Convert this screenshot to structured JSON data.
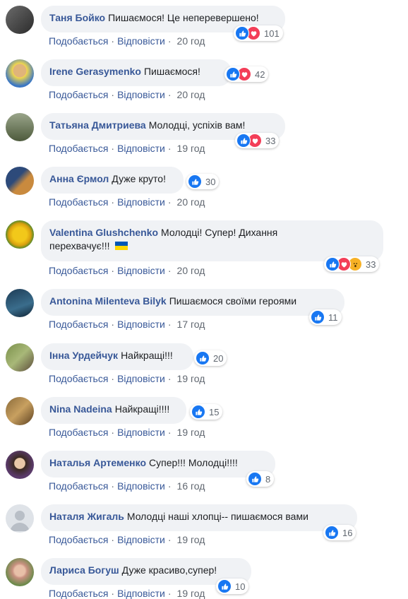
{
  "comments": [
    {
      "author": "Таня Бойко",
      "text": "Пишаємося! Це неперевершено!",
      "like": "Подобається",
      "reply": "Відповісти",
      "time": "20 год",
      "reactions": [
        "like",
        "love"
      ],
      "count": "101"
    },
    {
      "author": "Irene Gerasymenko",
      "text": "Пишаємося!",
      "like": "Подобається",
      "reply": "Відповісти",
      "time": "20 год",
      "reactions": [
        "like",
        "love"
      ],
      "count": "42"
    },
    {
      "author": "Татьяна Дмитриева",
      "text": "Молодці, успіхів вам!",
      "like": "Подобається",
      "reply": "Відповісти",
      "time": "19 год",
      "reactions": [
        "like",
        "love"
      ],
      "count": "33"
    },
    {
      "author": "Анна Єрмол",
      "text": "Дуже круто!",
      "like": "Подобається",
      "reply": "Відповісти",
      "time": "20 год",
      "reactions": [
        "like"
      ],
      "count": "30"
    },
    {
      "author": "Valentina Glushchenko",
      "text": "Молодці! Супер! Дихання",
      "text2": "перехвачує!!!",
      "like": "Подобається",
      "reply": "Відповісти",
      "time": "20 год",
      "reactions": [
        "like",
        "love",
        "wow"
      ],
      "count": "33"
    },
    {
      "author": "Antonina Milenteva Bilyk",
      "text": "Пишаємося своїми героями",
      "like": "Подобається",
      "reply": "Відповісти",
      "time": "17 год",
      "reactions": [
        "like"
      ],
      "count": "11"
    },
    {
      "author": "Інна Урдейчук",
      "text": "Найкращі!!!",
      "like": "Подобається",
      "reply": "Відповісти",
      "time": "19 год",
      "reactions": [
        "like"
      ],
      "count": "20"
    },
    {
      "author": "Nina Nadeina",
      "text": "Найкращі!!!!",
      "like": "Подобається",
      "reply": "Відповісти",
      "time": "19 год",
      "reactions": [
        "like"
      ],
      "count": "15"
    },
    {
      "author": "Наталья Артеменко",
      "text": "Супер!!! Молодці!!!!",
      "like": "Подобається",
      "reply": "Відповісти",
      "time": "16 год",
      "reactions": [
        "like"
      ],
      "count": "8"
    },
    {
      "author": "Наталя Жигаль",
      "text": "Молодці наші хлопці-- пишаємося вами",
      "like": "Подобається",
      "reply": "Відповісти",
      "time": "19 год",
      "reactions": [
        "like"
      ],
      "count": "16"
    },
    {
      "author": "Лариса Богуш",
      "text": "Дуже красиво,супер!",
      "like": "Подобається",
      "reply": "Відповісти",
      "time": "19 год",
      "reactions": [
        "like"
      ],
      "count": "10"
    }
  ],
  "colors": {
    "link": "#385898",
    "bubble": "#f0f2f5",
    "like": "#1877f2",
    "love": "#f33e58",
    "wow": "#f7b125"
  },
  "icons": {
    "like": "thumbs-up-icon",
    "love": "heart-icon",
    "wow": "wow-face-icon"
  }
}
